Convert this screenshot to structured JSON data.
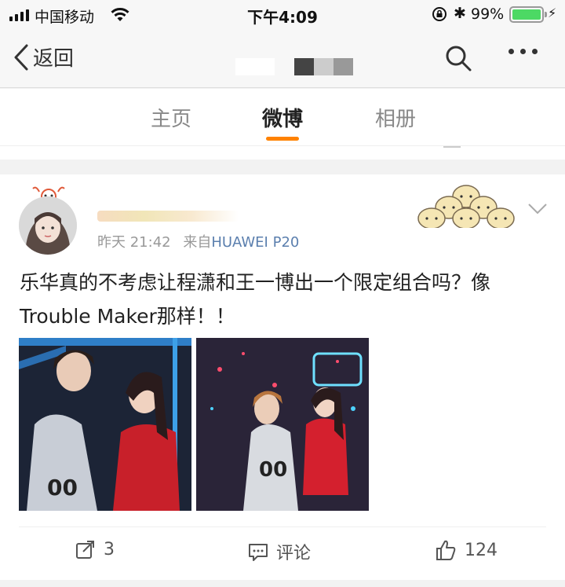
{
  "status_bar": {
    "carrier": "中国移动",
    "time": "下午4:09",
    "battery_percent": "99%",
    "battery_level": 0.99,
    "icons": [
      "signal-icon",
      "wifi-icon",
      "rotation-lock-icon",
      "bluetooth-icon",
      "battery-icon",
      "charging-icon"
    ]
  },
  "nav": {
    "back_label": "返回",
    "icons": [
      "back-chevron-icon",
      "search-icon",
      "more-icon"
    ]
  },
  "tabs": [
    {
      "label": "主页",
      "active": false
    },
    {
      "label": "微博",
      "active": true
    },
    {
      "label": "相册",
      "active": false
    }
  ],
  "post": {
    "time": "昨天 21:42",
    "source_prefix": "来自",
    "source": "HUAWEI P20",
    "text": "乐华真的不考虑让程潇和王一博出一个限定组合吗？像Trouble Maker那样！！",
    "images": [
      {
        "jersey": "00"
      },
      {
        "jersey": "00"
      }
    ],
    "actions": {
      "repost_count": "3",
      "comment_label": "评论",
      "like_count": "124"
    }
  },
  "colors": {
    "accent": "#ff8200",
    "link": "#5b7fae",
    "battery_green": "#4cd964"
  }
}
